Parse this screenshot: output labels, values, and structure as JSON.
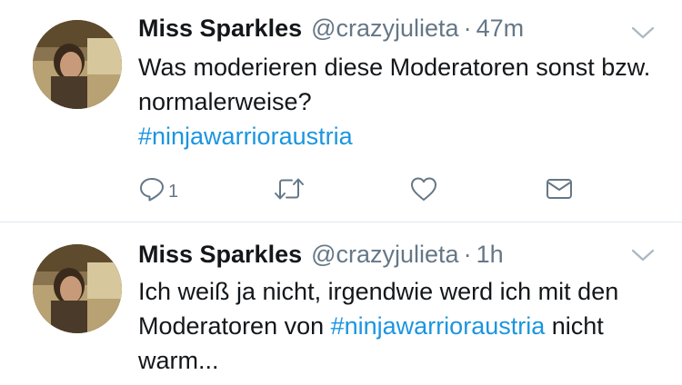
{
  "tweets": [
    {
      "display_name": "Miss Sparkles",
      "handle": "@crazyjulieta",
      "separator": "·",
      "time": "47m",
      "text_before": "Was moderieren diese Moderatoren sonst bzw. normalerweise?",
      "hashtag": "#ninjawarrioraustria",
      "text_after": "",
      "actions": {
        "reply_count": "1"
      }
    },
    {
      "display_name": "Miss Sparkles",
      "handle": "@crazyjulieta",
      "separator": "·",
      "time": "1h",
      "text_before": "Ich weiß ja nicht, irgendwie werd ich mit den Moderatoren von ",
      "hashtag": "#ninjawarrioraustria",
      "text_after": " nicht warm..."
    }
  ],
  "colors": {
    "link": "#1b95e0",
    "secondary": "#657786",
    "divider": "#e1e8ed"
  }
}
